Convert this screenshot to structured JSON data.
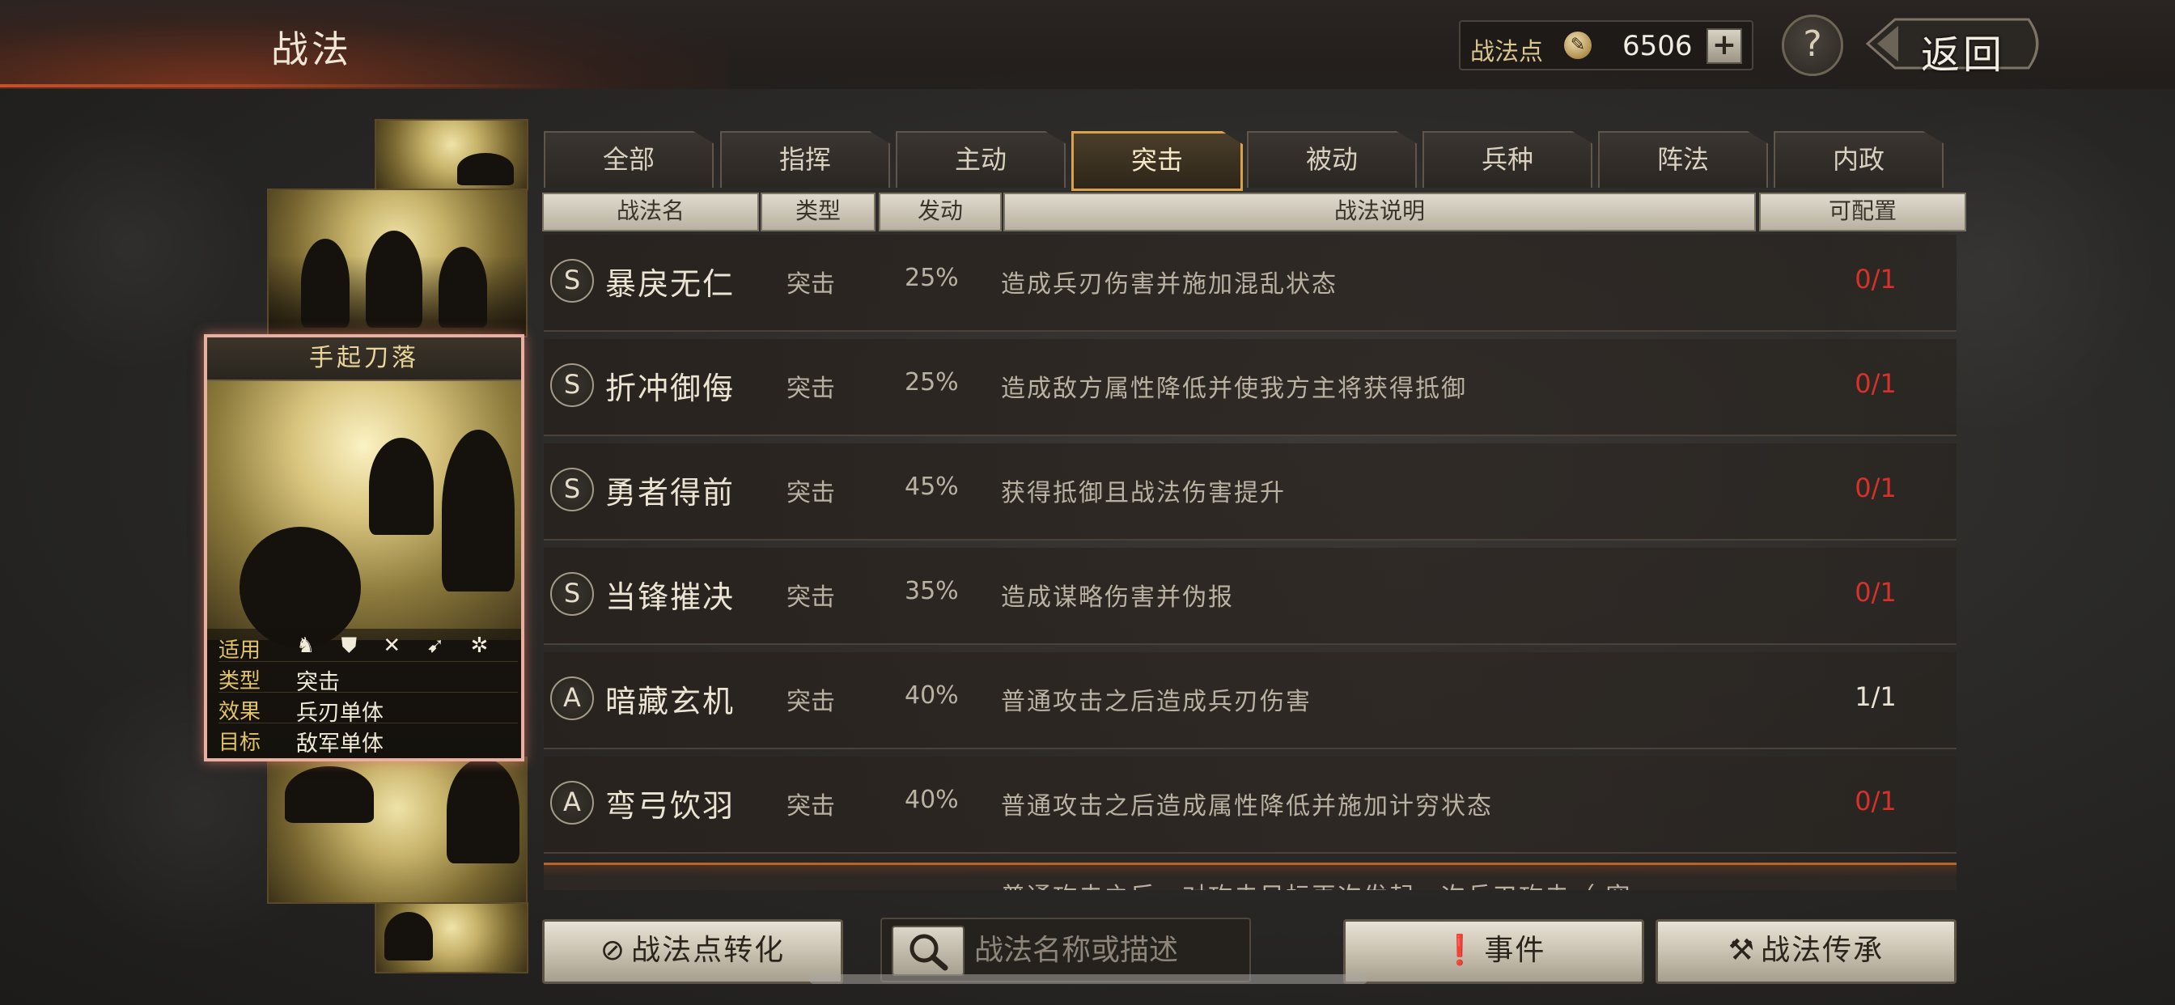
{
  "header": {
    "title": "战法",
    "points_label": "战法点",
    "points_value": "6506",
    "plus_label": "+",
    "help_label": "?",
    "back_label": "返回"
  },
  "card": {
    "title": "手起刀落",
    "info": [
      {
        "key": "适用",
        "value": "♞ ⛊ ✕ ➹ ✲"
      },
      {
        "key": "类型",
        "value": "突击"
      },
      {
        "key": "效果",
        "value": "兵刃单体"
      },
      {
        "key": "目标",
        "value": "敌军单体"
      }
    ]
  },
  "tabs": [
    {
      "label": "全部",
      "active": false
    },
    {
      "label": "指挥",
      "active": false
    },
    {
      "label": "主动",
      "active": false
    },
    {
      "label": "突击",
      "active": true
    },
    {
      "label": "被动",
      "active": false
    },
    {
      "label": "兵种",
      "active": false
    },
    {
      "label": "阵法",
      "active": false
    },
    {
      "label": "内政",
      "active": false
    }
  ],
  "columns": [
    "战法名",
    "类型",
    "发动",
    "战法说明",
    "可配置"
  ],
  "skills": [
    {
      "grade": "S",
      "name": "暴戾无仁",
      "type": "突击",
      "rate": "25%",
      "desc": "造成兵刃伤害并施加混乱状态",
      "config": "0/1",
      "config_color": "#d8302a"
    },
    {
      "grade": "S",
      "name": "折冲御侮",
      "type": "突击",
      "rate": "25%",
      "desc": "造成敌方属性降低并使我方主将获得抵御",
      "config": "0/1",
      "config_color": "#d8302a"
    },
    {
      "grade": "S",
      "name": "勇者得前",
      "type": "突击",
      "rate": "45%",
      "desc": "获得抵御且战法伤害提升",
      "config": "0/1",
      "config_color": "#d8302a"
    },
    {
      "grade": "S",
      "name": "当锋摧决",
      "type": "突击",
      "rate": "35%",
      "desc": "造成谋略伤害并伪报",
      "config": "0/1",
      "config_color": "#d8302a"
    },
    {
      "grade": "A",
      "name": "暗藏玄机",
      "type": "突击",
      "rate": "40%",
      "desc": "普通攻击之后造成兵刃伤害",
      "config": "1/1",
      "config_color": "#ece4d3"
    },
    {
      "grade": "A",
      "name": "弯弓饮羽",
      "type": "突击",
      "rate": "40%",
      "desc": "普通攻击之后造成属性降低并施加计穷状态",
      "config": "0/1",
      "config_color": "#d8302a"
    },
    {
      "grade": "",
      "name": "",
      "type": "",
      "rate": "",
      "desc": "普通攻击之后，对攻击目标再次发起一次兵刃攻击（ 穷",
      "config": "",
      "config_color": "#d8302a"
    }
  ],
  "toolbar": {
    "convert_label": "战法点转化",
    "search_placeholder": "战法名称或描述",
    "events_label": "事件",
    "inherit_label": "战法传承"
  },
  "colors": {
    "accent_gold": "#d9a24a",
    "config_red": "#d8302a",
    "card_border": "#e7b0a0"
  }
}
